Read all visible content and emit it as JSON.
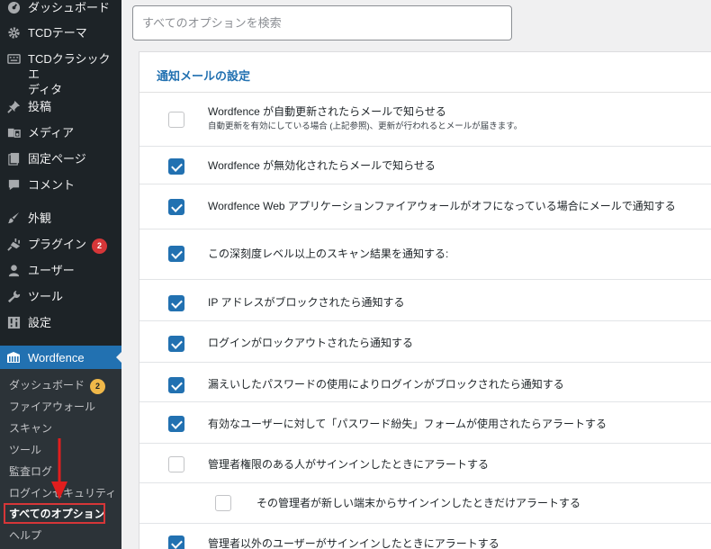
{
  "sidebar": {
    "items": [
      {
        "label": "ダッシュボード",
        "icon": "dashboard-icon"
      },
      {
        "label": "TCDテーマ",
        "icon": "gear-icon"
      },
      {
        "label": "TCDクラシックエディタ",
        "label_line1": "TCDクラシックエ",
        "label_line2": "ディタ",
        "icon": "keyboard-icon"
      },
      {
        "label": "投稿",
        "icon": "pin-icon"
      },
      {
        "label": "メディア",
        "icon": "media-icon"
      },
      {
        "label": "固定ページ",
        "icon": "page-icon"
      },
      {
        "label": "コメント",
        "icon": "comment-icon"
      },
      {
        "label": "外観",
        "icon": "brush-icon"
      },
      {
        "label": "プラグイン",
        "icon": "plugin-icon",
        "badge": "2"
      },
      {
        "label": "ユーザー",
        "icon": "user-icon"
      },
      {
        "label": "ツール",
        "icon": "wrench-icon"
      },
      {
        "label": "設定",
        "icon": "settings-icon"
      }
    ],
    "wordfence": {
      "label": "Wordfence",
      "icon": "wordfence-icon"
    },
    "submenu": [
      {
        "label": "ダッシュボード",
        "badge": "2"
      },
      {
        "label": "ファイアウォール"
      },
      {
        "label": "スキャン"
      },
      {
        "label": "ツール"
      },
      {
        "label": "監査ログ"
      },
      {
        "label": "ログインセキュリティ"
      },
      {
        "label": "すべてのオプション"
      },
      {
        "label": "ヘルプ"
      }
    ]
  },
  "search": {
    "placeholder": "すべてのオプションを検索"
  },
  "panel": {
    "title": "通知メールの設定",
    "rows": [
      {
        "label": "Wordfence が自動更新されたらメールで知らせる",
        "sub": "自動更新を有効にしている場合 (上記参照)、更新が行われるとメールが届きます。",
        "checked": false
      },
      {
        "label": "Wordfence が無効化されたらメールで知らせる",
        "checked": true
      },
      {
        "label": "Wordfence Web アプリケーションファイアウォールがオフになっている場合にメールで通知する",
        "checked": true
      },
      {
        "label": "この深刻度レベル以上のスキャン結果を通知する:",
        "checked": true
      },
      {
        "label": "IP アドレスがブロックされたら通知する",
        "checked": true
      },
      {
        "label": "ログインがロックアウトされたら通知する",
        "checked": true
      },
      {
        "label": "漏えいしたパスワードの使用によりログインがブロックされたら通知する",
        "checked": true
      },
      {
        "label": "有効なユーザーに対して「パスワード紛失」フォームが使用されたらアラートする",
        "checked": true
      },
      {
        "label": "管理者権限のある人がサインインしたときにアラートする",
        "checked": false
      },
      {
        "label": "その管理者が新しい端末からサインインしたときだけアラートする",
        "checked": false
      },
      {
        "label": "管理者以外のユーザーがサインインしたときにアラートする",
        "checked": true
      }
    ]
  }
}
